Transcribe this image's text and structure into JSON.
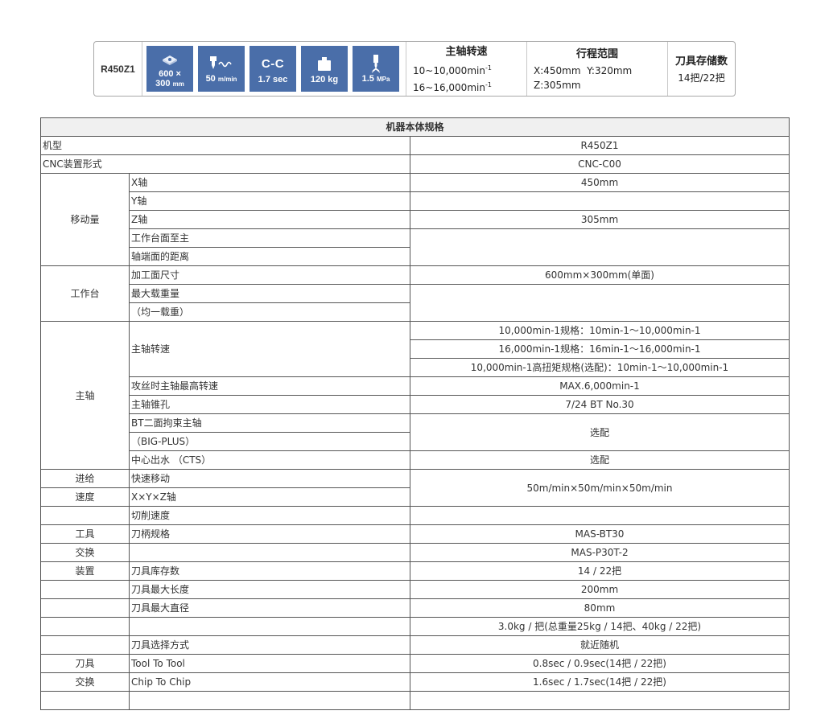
{
  "banner": {
    "model": "R450Z1",
    "icons": [
      {
        "name": "table-size-icon",
        "line1": "600 ×",
        "line2": "300",
        "unit": "mm"
      },
      {
        "name": "feed-rate-icon",
        "value": "50",
        "unit": "m/min"
      },
      {
        "name": "chip-to-chip-icon",
        "big": "C-C",
        "value": "1.7 sec"
      },
      {
        "name": "weight-icon",
        "value": "120 kg"
      },
      {
        "name": "pressure-icon",
        "value": "1.5",
        "unit": "MPa"
      }
    ],
    "spindle_speed": {
      "title": "主轴转速",
      "line1": "10~10,000min",
      "line2": "16~16,000min",
      "sup": "-1"
    },
    "travel": {
      "title": "行程范围",
      "line1": "X:450mm  Y:320mm",
      "line2": "Z:305mm"
    },
    "tool_storage": {
      "title": "刀具存储数",
      "value": "14把/22把"
    }
  },
  "table": {
    "title": "机器本体规格",
    "r_model": {
      "label": "机型",
      "value": "R450Z1"
    },
    "r_cnc": {
      "label": "CNC装置形式",
      "value": "CNC-C00"
    },
    "travel": {
      "group": "移动量",
      "x_label": "X轴",
      "x_value": "450mm",
      "y_label": "Y轴",
      "y_value": "",
      "z_label": "Z轴",
      "z_value": "305mm",
      "dist_label1": "工作台面至主",
      "dist_label2": "轴端面的距离",
      "dist_value": ""
    },
    "worktable": {
      "group": "工作台",
      "area_label": "加工面尺寸",
      "area_value": "600mm×300mm(单面)",
      "load_label1": "最大载重量",
      "load_label2": "（均一载重）",
      "load_value": ""
    },
    "spindle": {
      "group": "主轴",
      "speed_label": "主轴转速",
      "speed_1": "10,000min-1规格：10min-1～10,000min-1",
      "speed_2": "16,000min-1规格：16min-1～16,000min-1",
      "speed_3": "10,000min-1高扭矩规格(选配)：10min-1～10,000min-1",
      "tap_label": "攻丝时主轴最高转速",
      "tap_value": "MAX.6,000min-1",
      "taper_label": "主轴锥孔",
      "taper_value": "7/24 BT No.30",
      "bt_label1": "BT二面拘束主轴",
      "bt_label2": "（BIG-PLUS）",
      "bt_value": "选配",
      "cts_label": "中心出水 （CTS）",
      "cts_value": "选配"
    },
    "feed": {
      "group1": "进给",
      "group2": "速度",
      "rapid_label": "快速移动",
      "axes_label": "X×Y×Z轴",
      "rapid_value": "50m/min×50m/min×50m/min",
      "cut_label": "切削速度",
      "cut_value": ""
    },
    "atc": {
      "group1": "工具",
      "group2": "交换",
      "group3": "装置",
      "holder_label": "刀柄规格",
      "holder_value": "MAS-BT30",
      "pull_label": "",
      "pull_value": "MAS-P30T-2",
      "cap_label": "刀具库存数",
      "cap_value": "14 / 22把",
      "len_label": "刀具最大长度",
      "len_value": "200mm",
      "dia_label": "刀具最大直径",
      "dia_value": "80mm",
      "wt_label": "",
      "wt_value": "3.0kg / 把(总重量25kg / 14把、40kg / 22把)",
      "sel_label": "刀具选择方式",
      "sel_value": "就近随机"
    },
    "change": {
      "group1": "刀具",
      "group2": "交换",
      "t2t_label": "Tool To Tool",
      "t2t_value": "0.8sec / 0.9sec(14把 / 22把)",
      "c2c_label": "Chip To Chip",
      "c2c_value": "1.6sec / 1.7sec(14把 / 22把)"
    }
  }
}
